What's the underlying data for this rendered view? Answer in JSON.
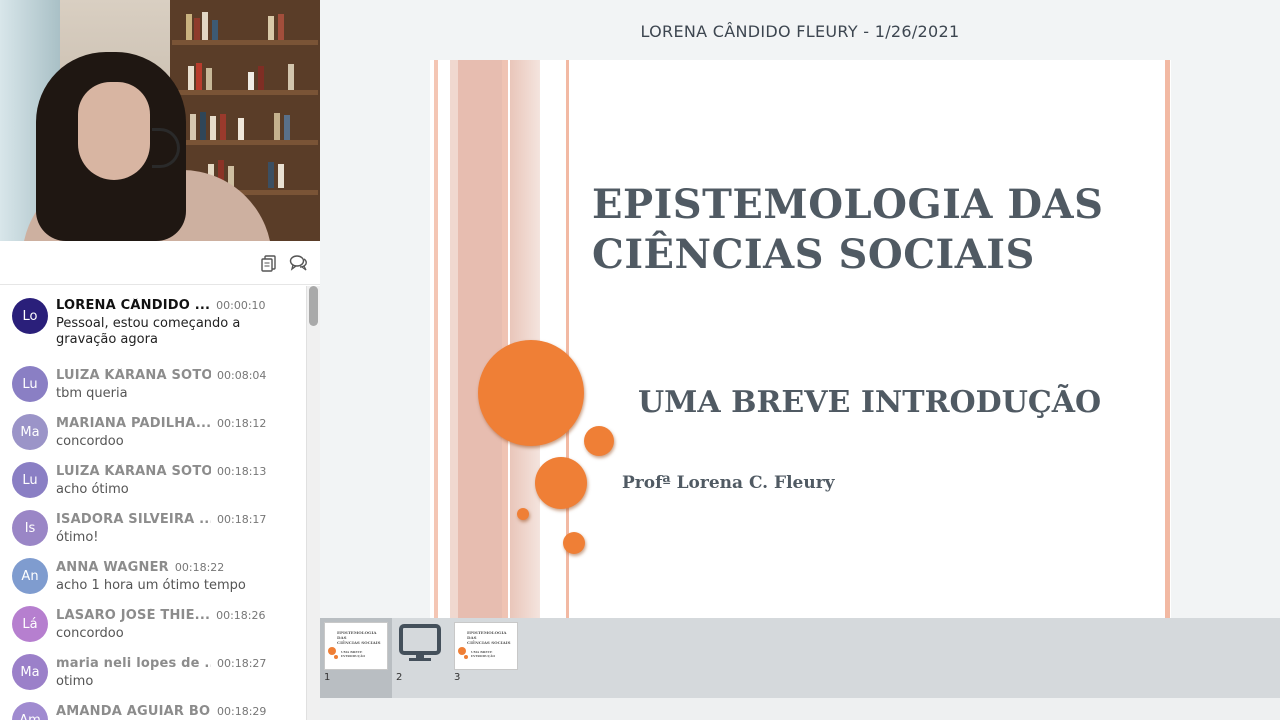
{
  "header": {
    "title": "LORENA CÂNDIDO FLEURY - 1/26/2021"
  },
  "slide": {
    "title_line1": "EPISTEMOLOGIA DAS",
    "title_line2": "CIÊNCIAS SOCIAIS",
    "subtitle": "UMA BREVE INTRODUÇÃO",
    "author": "Profª Lorena C. Fleury",
    "accent_color": "#ef7f36",
    "text_color": "#505a63"
  },
  "chat": {
    "messages": [
      {
        "initials": "Lo",
        "author": "LORENA CÂNDIDO ...",
        "time": "00:00:10",
        "text": "Pessoal, estou começando a gravação agora",
        "color": "#2a1f7a"
      },
      {
        "initials": "Lu",
        "author": "LUIZA KÂRANA SOTO ...",
        "time": "00:08:04",
        "text": "tbm queria",
        "color": "#8a7fc4"
      },
      {
        "initials": "Ma",
        "author": "MARIANA PADILHA...",
        "time": "00:18:12",
        "text": "concordoo",
        "color": "#9b94c8"
      },
      {
        "initials": "Lu",
        "author": "LUIZA KÂRANA SOTO ...",
        "time": "00:18:13",
        "text": "acho ótimo",
        "color": "#8a7fc4"
      },
      {
        "initials": "Is",
        "author": "ISADORA SILVEIRA ...",
        "time": "00:18:17",
        "text": "ótimo!",
        "color": "#9a86c6"
      },
      {
        "initials": "An",
        "author": "ANNA WAGNER",
        "time": "00:18:22",
        "text": "acho 1 hora um ótimo tempo",
        "color": "#7f9ccf"
      },
      {
        "initials": "Lá",
        "author": "LÁSARO JOSÉ THIE...",
        "time": "00:18:26",
        "text": "concordoo",
        "color": "#b67fcf"
      },
      {
        "initials": "Ma",
        "author": "maria neli lopes de ...",
        "time": "00:18:27",
        "text": "otimo",
        "color": "#9b80c9"
      },
      {
        "initials": "Am",
        "author": "AMANDA AGUIAR BO...",
        "time": "00:18:29",
        "text": "",
        "color": "#a08bd0"
      }
    ]
  },
  "thumbnails": [
    {
      "num": "1",
      "type": "slide",
      "active": true
    },
    {
      "num": "2",
      "type": "screen",
      "active": false
    },
    {
      "num": "3",
      "type": "slide",
      "active": false
    }
  ],
  "icons": {
    "copy": "copy-icon",
    "chat": "chat-bubbles-icon",
    "screen": "monitor-icon"
  }
}
